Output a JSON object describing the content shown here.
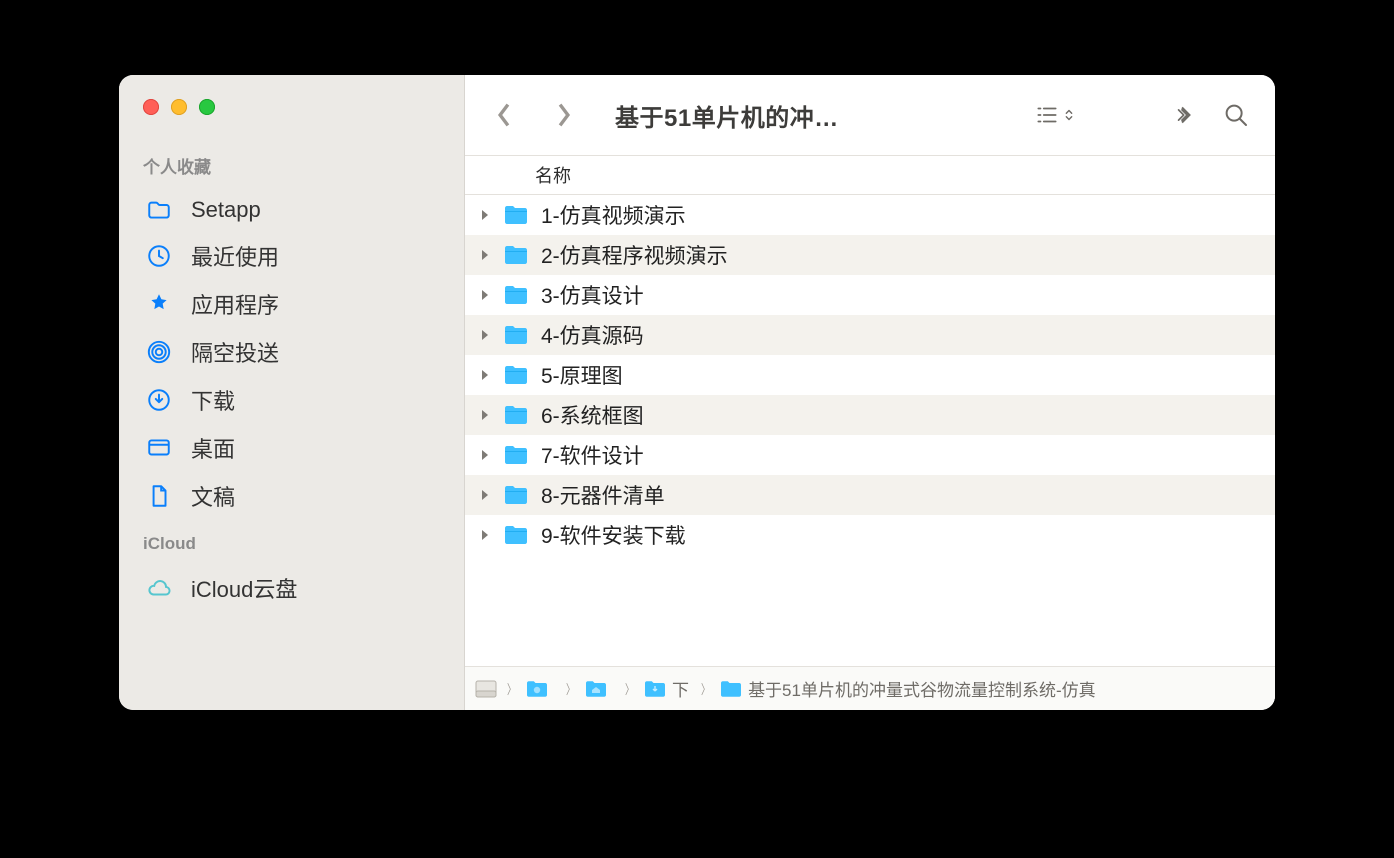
{
  "window": {
    "title": "基于51单片机的冲…"
  },
  "sidebar": {
    "sections": [
      {
        "title": "个人收藏",
        "items": [
          {
            "icon": "folder-icon",
            "label": "Setapp"
          },
          {
            "icon": "clock-icon",
            "label": "最近使用"
          },
          {
            "icon": "appstore-icon",
            "label": "应用程序"
          },
          {
            "icon": "airdrop-icon",
            "label": "隔空投送"
          },
          {
            "icon": "download-icon",
            "label": "下载"
          },
          {
            "icon": "desktop-icon",
            "label": "桌面"
          },
          {
            "icon": "doc-icon",
            "label": "文稿"
          }
        ]
      },
      {
        "title": "iCloud",
        "items": [
          {
            "icon": "icloud-icon",
            "label": "iCloud云盘"
          }
        ]
      }
    ]
  },
  "list": {
    "column_header": "名称",
    "rows": [
      {
        "name": "1-仿真视频演示"
      },
      {
        "name": "2-仿真程序视频演示"
      },
      {
        "name": "3-仿真设计"
      },
      {
        "name": "4-仿真源码"
      },
      {
        "name": "5-原理图"
      },
      {
        "name": "6-系统框图"
      },
      {
        "name": "7-软件设计"
      },
      {
        "name": "8-元器件清单"
      },
      {
        "name": "9-软件安装下载"
      }
    ]
  },
  "pathbar": {
    "segments": [
      {
        "kind": "disk",
        "label": ""
      },
      {
        "kind": "folder",
        "label": ""
      },
      {
        "kind": "folder",
        "label": ""
      },
      {
        "kind": "folder",
        "label": "下"
      },
      {
        "kind": "folder",
        "label": "基于51单片机的冲量式谷物流量控制系统-仿真"
      }
    ]
  }
}
